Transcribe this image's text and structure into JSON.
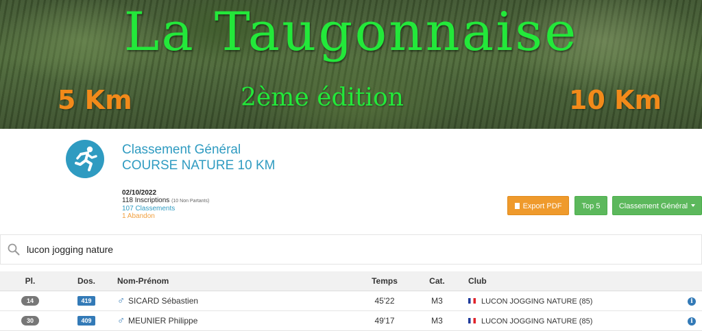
{
  "banner": {
    "title": "La Taugonnaise",
    "left_distance": "5 Km",
    "subtitle": "2ème édition",
    "right_distance": "10 Km"
  },
  "race": {
    "title": "Classement Général",
    "subtitle": "COURSE NATURE 10 KM",
    "date": "02/10/2022",
    "inscriptions": "118 Inscriptions",
    "non_partants": "(10 Non Partants)",
    "classements": "107 Classements",
    "abandon": "1 Abandon"
  },
  "actions": {
    "export_pdf": "Export PDF",
    "top5": "Top 5",
    "classement": "Classement Général"
  },
  "search": {
    "value": "lucon jogging nature",
    "placeholder": ""
  },
  "table": {
    "headers": {
      "pl": "Pl.",
      "dos": "Dos.",
      "nom": "Nom-Prénom",
      "temps": "Temps",
      "cat": "Cat.",
      "club": "Club"
    },
    "rows": [
      {
        "pl": "14",
        "dos": "419",
        "gender": "male-icon",
        "name": "SICARD Sébastien",
        "time": "45'22",
        "cat": "M3",
        "club": "LUCON JOGGING NATURE (85)"
      },
      {
        "pl": "30",
        "dos": "409",
        "gender": "male-icon",
        "name": "MEUNIER Philippe",
        "time": "49'17",
        "cat": "M3",
        "club": "LUCON JOGGING NATURE (85)"
      }
    ]
  },
  "colors": {
    "accent": "#2f9bc1",
    "title_green": "#23e83a",
    "distance_orange": "#f28a1a",
    "pdf_orange": "#ef9a2c",
    "green_button": "#5cb85c",
    "abandon_orange": "#f0a040"
  }
}
